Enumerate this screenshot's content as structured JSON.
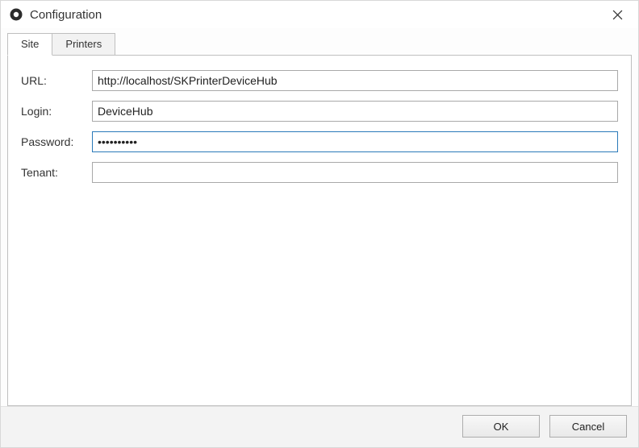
{
  "window": {
    "title": "Configuration"
  },
  "tabs": {
    "site": "Site",
    "printers": "Printers"
  },
  "labels": {
    "url": "URL:",
    "login": "Login:",
    "password": "Password:",
    "tenant": "Tenant:"
  },
  "fields": {
    "url": "http://localhost/SKPrinterDeviceHub",
    "login": "DeviceHub",
    "password": "••••••••••",
    "tenant": ""
  },
  "buttons": {
    "ok": "OK",
    "cancel": "Cancel"
  }
}
